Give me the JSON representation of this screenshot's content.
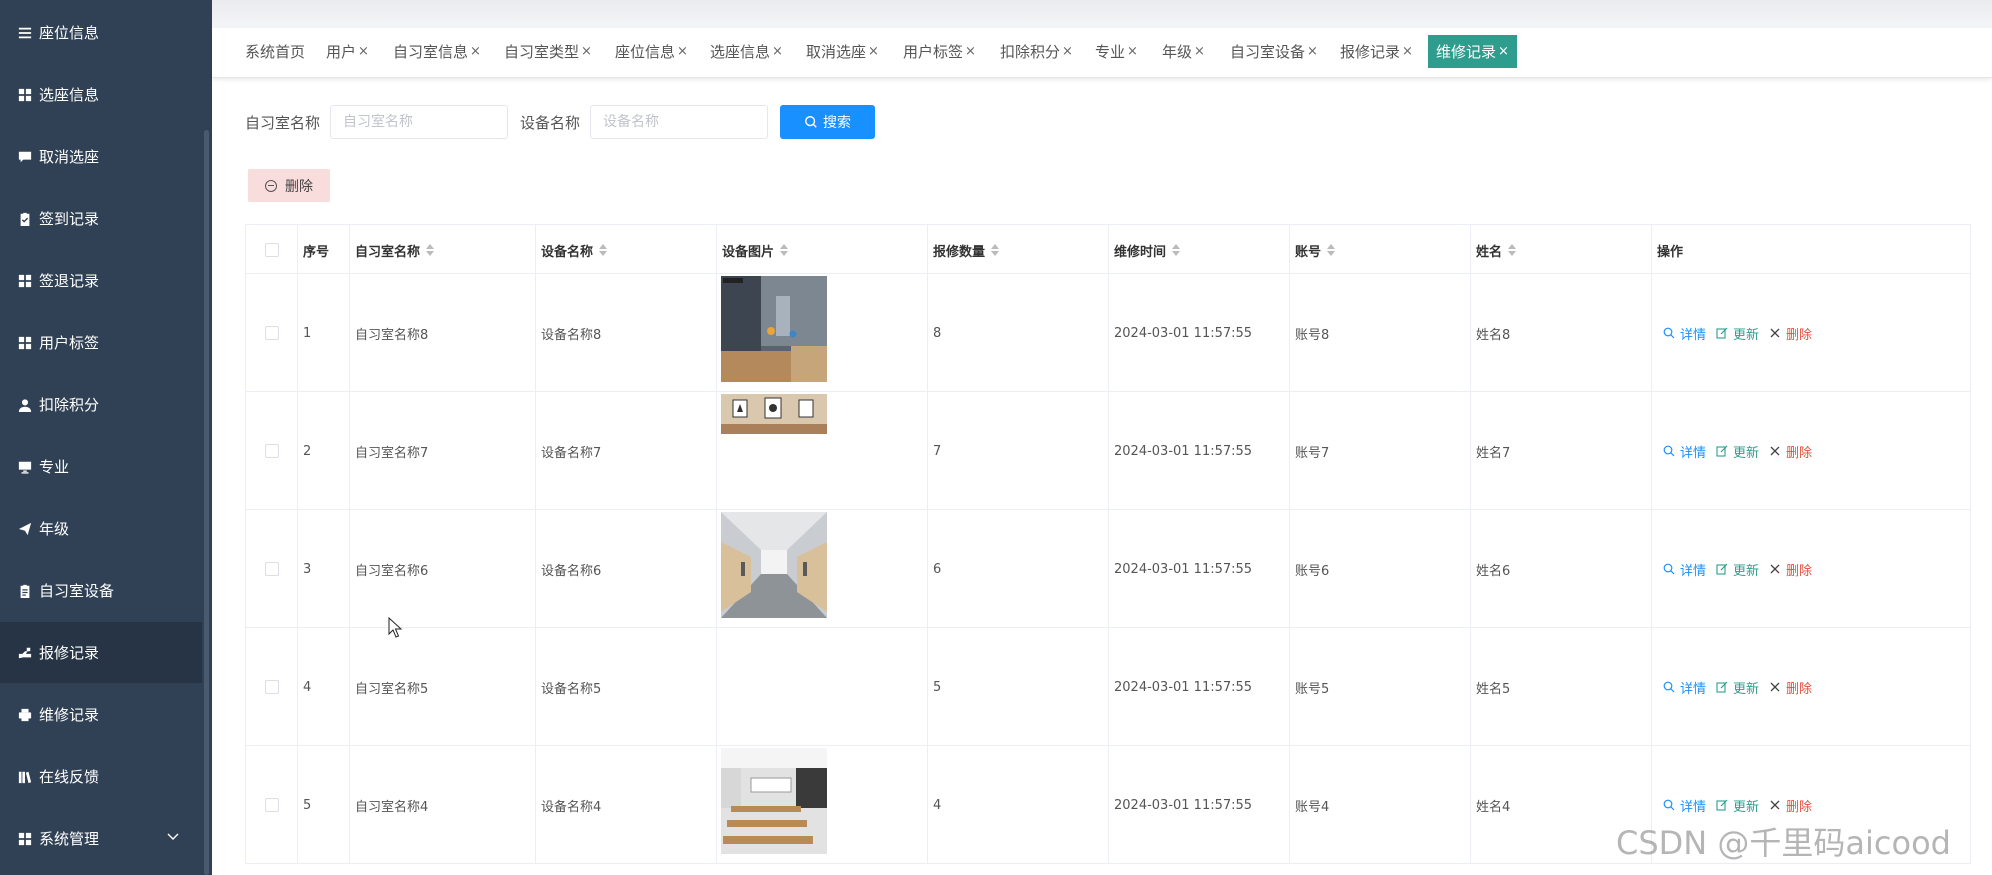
{
  "sidebar": {
    "items": [
      {
        "label": "座位信息",
        "icon": "list-icon"
      },
      {
        "label": "选座信息",
        "icon": "grid-icon"
      },
      {
        "label": "取消选座",
        "icon": "chat-icon"
      },
      {
        "label": "签到记录",
        "icon": "clipboard-check-icon"
      },
      {
        "label": "签退记录",
        "icon": "grid-icon"
      },
      {
        "label": "用户标签",
        "icon": "grid-icon"
      },
      {
        "label": "扣除积分",
        "icon": "user-icon"
      },
      {
        "label": "专业",
        "icon": "monitor-icon"
      },
      {
        "label": "年级",
        "icon": "paper-plane-icon"
      },
      {
        "label": "自习室设备",
        "icon": "clipboard-icon"
      },
      {
        "label": "报修记录",
        "icon": "hand-icon"
      },
      {
        "label": "维修记录",
        "icon": "printer-icon"
      },
      {
        "label": "在线反馈",
        "icon": "books-icon"
      },
      {
        "label": "系统管理",
        "icon": "grid-icon"
      }
    ],
    "active_index": 10
  },
  "tags": [
    {
      "label": "系统首页",
      "closable": false
    },
    {
      "label": "用户",
      "closable": true
    },
    {
      "label": "自习室信息",
      "closable": true
    },
    {
      "label": "自习室类型",
      "closable": true
    },
    {
      "label": "座位信息",
      "closable": true
    },
    {
      "label": "选座信息",
      "closable": true
    },
    {
      "label": "取消选座",
      "closable": true
    },
    {
      "label": "用户标签",
      "closable": true
    },
    {
      "label": "扣除积分",
      "closable": true
    },
    {
      "label": "专业",
      "closable": true
    },
    {
      "label": "年级",
      "closable": true
    },
    {
      "label": "自习室设备",
      "closable": true
    },
    {
      "label": "报修记录",
      "closable": true
    },
    {
      "label": "维修记录",
      "closable": true,
      "active": true
    }
  ],
  "tag_close_glyph": "×",
  "search": {
    "room_label": "自习室名称",
    "room_placeholder": "自习室名称",
    "device_label": "设备名称",
    "device_placeholder": "设备名称",
    "search_button": "搜索"
  },
  "toolbar": {
    "delete_button": "删除"
  },
  "table": {
    "headers": {
      "index": "序号",
      "room": "自习室名称",
      "device": "设备名称",
      "image": "设备图片",
      "count": "报修数量",
      "time": "维修时间",
      "account": "账号",
      "name": "姓名",
      "ops": "操作"
    },
    "rows": [
      {
        "index": "1",
        "room": "自习室名称8",
        "device": "设备名称8",
        "image": "photo-lamp-room",
        "count": "8",
        "time": "2024-03-01 11:57:55",
        "account": "账号8",
        "name": "姓名8"
      },
      {
        "index": "2",
        "room": "自习室名称7",
        "device": "设备名称7",
        "image": "photo-wall-frames",
        "count": "7",
        "time": "2024-03-01 11:57:55",
        "account": "账号7",
        "name": "姓名7"
      },
      {
        "index": "3",
        "room": "自习室名称6",
        "device": "设备名称6",
        "image": "photo-corridor",
        "count": "6",
        "time": "2024-03-01 11:57:55",
        "account": "账号6",
        "name": "姓名6"
      },
      {
        "index": "4",
        "room": "自习室名称5",
        "device": "设备名称5",
        "image": "",
        "count": "5",
        "time": "2024-03-01 11:57:55",
        "account": "账号5",
        "name": "姓名5"
      },
      {
        "index": "5",
        "room": "自习室名称4",
        "device": "设备名称4",
        "image": "photo-study-hall",
        "count": "4",
        "time": "2024-03-01 11:57:55",
        "account": "账号4",
        "name": "姓名4"
      }
    ],
    "actions": {
      "detail": "详情",
      "update": "更新",
      "delete": "删除"
    }
  },
  "watermark": "CSDN @千里码aicood",
  "colors": {
    "sidebar_bg": "#304156",
    "sidebar_active": "#263445",
    "tag_active": "#2e9d8e",
    "primary": "#1890ff",
    "danger": "#e74c3c",
    "delete_bg": "#f9dcdc"
  }
}
